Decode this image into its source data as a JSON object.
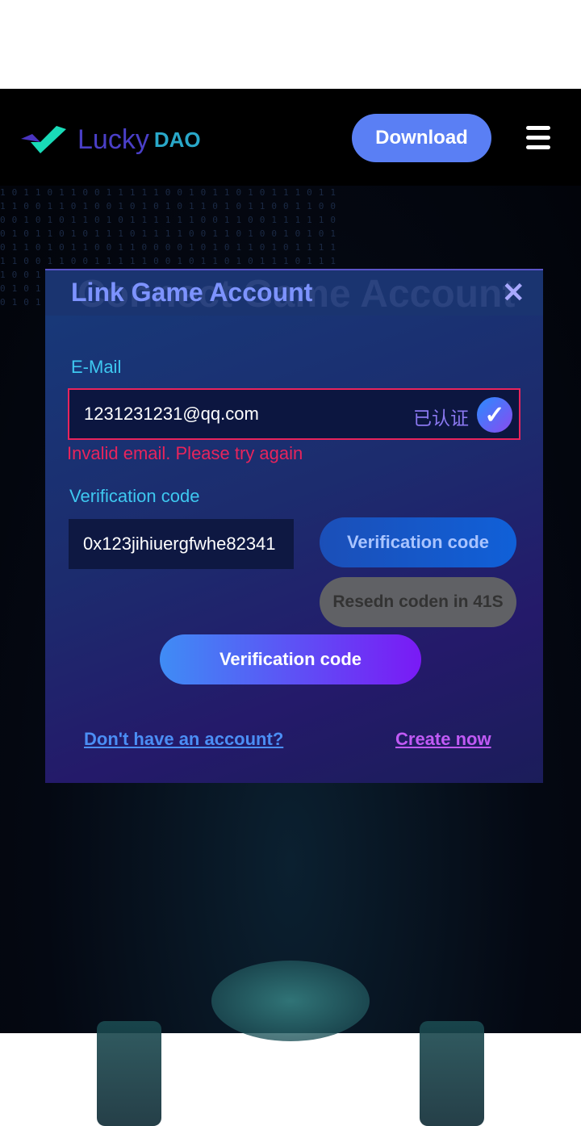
{
  "header": {
    "logo_text": "Lucky",
    "logo_suffix": "DAO",
    "download_label": "Download",
    "menu_icon": "hamburger-icon"
  },
  "background": {
    "digits": "1011011001111100101101011101111001101001010101101011001100001010110101111110011001111100101101011101111001101001010101101011001100001010110101111110011001111100101101011101111001101001010101101011001100001010110101111110011011101000010111010100110",
    "ghost_title": "Connect Game Account"
  },
  "modal": {
    "title": "Link Game Account",
    "close_icon": "close-icon",
    "email_label": "E-Mail",
    "email_value": "1231231231@qq.com",
    "verified_text": "已认证",
    "error_text": "Invalid email. Please try again",
    "code_label": "Verification code",
    "code_value": "0x123jihiuergfwhe82341",
    "send_code_label": "Verification code",
    "resend_label": "Resedn coden in 41S",
    "submit_label": "Verification code",
    "no_account_link": "Don't have an account?",
    "create_link": "Create now"
  },
  "colors": {
    "accent": "#5a7ff4",
    "error": "#e8245c",
    "label": "#3ec8f0",
    "create_link": "#c05af5"
  }
}
